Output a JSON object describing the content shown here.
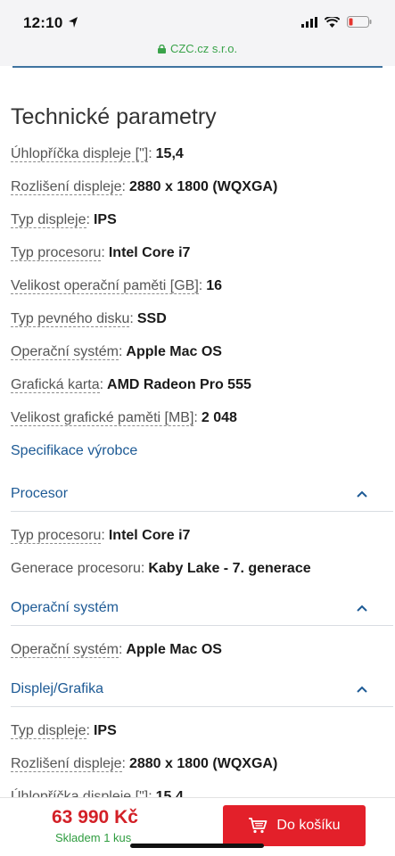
{
  "status": {
    "time": "12:10",
    "url": "CZC.cz s.r.o."
  },
  "section_title": "Technické parametry",
  "params": [
    {
      "label": "Úhlopříčka displeje [\"]",
      "value": "15,4"
    },
    {
      "label": "Rozlišení displeje",
      "value": "2880 x 1800 (WQXGA)"
    },
    {
      "label": "Typ displeje",
      "value": "IPS"
    },
    {
      "label": "Typ procesoru",
      "value": "Intel Core i7"
    },
    {
      "label": "Velikost operační paměti [GB]",
      "value": "16"
    },
    {
      "label": "Typ pevného disku",
      "value": "SSD"
    },
    {
      "label": "Operační systém",
      "value": "Apple Mac OS"
    },
    {
      "label": "Grafická karta",
      "value": "AMD Radeon Pro 555"
    },
    {
      "label": "Velikost grafické paměti [MB]",
      "value": "2 048"
    }
  ],
  "spec_link": "Specifikace výrobce",
  "groups": [
    {
      "title": "Procesor",
      "rows": [
        {
          "label": "Typ procesoru",
          "value": "Intel Core i7"
        },
        {
          "label": "Generace procesoru",
          "value": "Kaby Lake - 7. generace"
        }
      ]
    },
    {
      "title": "Operační systém",
      "rows": [
        {
          "label": "Operační systém",
          "value": "Apple Mac OS"
        }
      ]
    },
    {
      "title": "Displej/Grafika",
      "rows": [
        {
          "label": "Typ displeje",
          "value": "IPS"
        },
        {
          "label": "Rozlišení displeje",
          "value": "2880 x 1800 (WQXGA)"
        },
        {
          "label": "Úhlopříčka displeje [\"]",
          "value": "15,4"
        }
      ]
    }
  ],
  "footer": {
    "price": "63 990 Kč",
    "stock": "Skladem 1 kus",
    "cart_label": "Do košíku"
  },
  "colors": {
    "accent_link": "#1d5a95",
    "price_red": "#d32027",
    "stock_green": "#2e9c3f",
    "button_red": "#e3202a"
  },
  "icons": [
    "location-arrow-icon",
    "signal-icon",
    "wifi-icon",
    "battery-icon",
    "lock-icon",
    "chevron-up-icon",
    "cart-icon"
  ]
}
